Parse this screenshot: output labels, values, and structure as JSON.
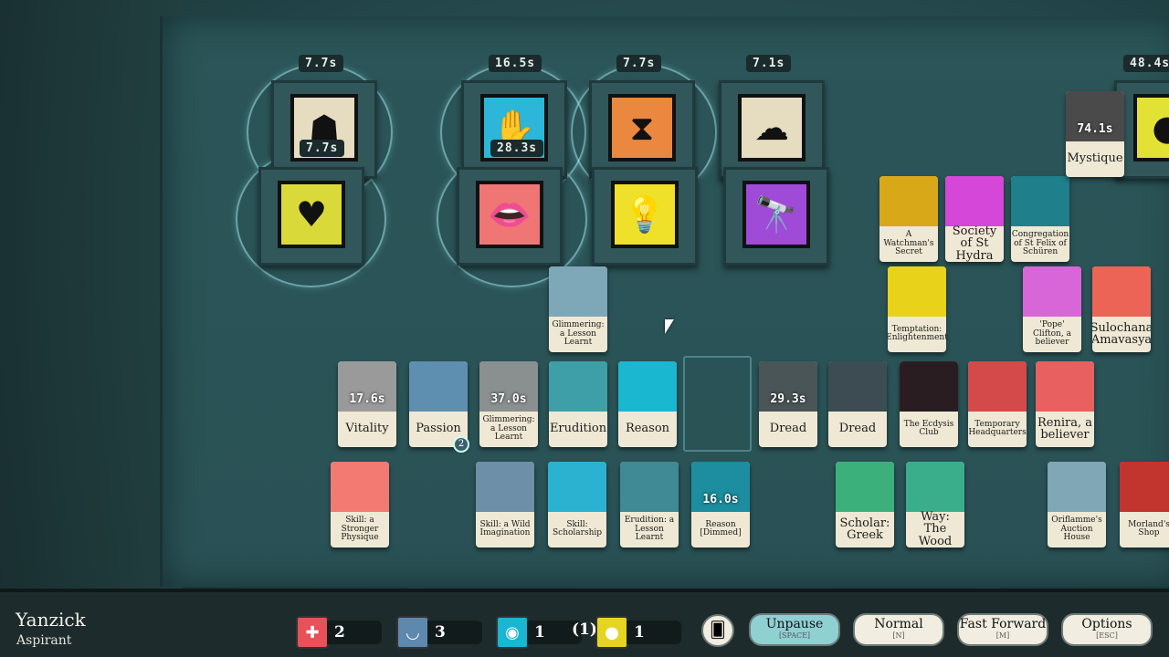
{
  "verbs": [
    {
      "icon": "mask-icon",
      "color": "#e6dcc0",
      "glyph": "☗",
      "timer": "7.7s"
    },
    {
      "icon": "heart-icon",
      "color": "#d9d93a",
      "glyph": "♥",
      "timer": "7.7s"
    },
    {
      "icon": "hand-eye-icon",
      "color": "#2cb6d9",
      "glyph": "✋",
      "timer": "16.5s"
    },
    {
      "icon": "lips-icon",
      "color": "#f07575",
      "glyph": "👄",
      "timer": "28.3s"
    },
    {
      "icon": "hourglass-icon",
      "color": "#e9883e",
      "glyph": "⧗",
      "timer": "7.7s"
    },
    {
      "icon": "lightbulb-icon",
      "color": "#efe02a",
      "glyph": "💡",
      "timer": ""
    },
    {
      "icon": "cloud-star-icon",
      "color": "#e6dcc0",
      "glyph": "☁",
      "timer": "7.1s"
    },
    {
      "icon": "telescope-icon",
      "color": "#a04ad8",
      "glyph": "🔭",
      "timer": ""
    },
    {
      "icon": "candle-icon",
      "color": "#e2e235",
      "glyph": "●",
      "timer": "48.4s"
    }
  ],
  "cards": [
    {
      "label": "Glimmering: a Lesson Learnt",
      "color": "#7ea8b8",
      "timer": ""
    },
    {
      "label": "Vitality",
      "color": "#9a9a9a",
      "timer": "17.6s",
      "big": true
    },
    {
      "label": "Passion",
      "color": "#5f8fb0",
      "timer": "",
      "big": true,
      "badge": "2"
    },
    {
      "label": "Glimmering: a Lesson Learnt",
      "color": "#8a8f90",
      "timer": "37.0s"
    },
    {
      "label": "Erudition",
      "color": "#3f9fa8",
      "timer": "",
      "big": true
    },
    {
      "label": "Reason",
      "color": "#19b7d0",
      "timer": "",
      "big": true
    },
    {
      "label": "Dread",
      "color": "#4a5558",
      "timer": "29.3s",
      "big": true
    },
    {
      "label": "Dread",
      "color": "#3c4c52",
      "timer": "",
      "big": true
    },
    {
      "label": "The Ecdysis Club",
      "color": "#2a1d22",
      "timer": ""
    },
    {
      "label": "Temporary Headquarters",
      "color": "#d44a4a",
      "timer": ""
    },
    {
      "label": "Renira, a believer",
      "color": "#e86060",
      "timer": "",
      "big": true
    },
    {
      "label": "Skill: a Stronger Physique",
      "color": "#f27a72",
      "timer": ""
    },
    {
      "label": "Skill: a Wild Imagination",
      "color": "#6d8fa8",
      "timer": ""
    },
    {
      "label": "Skill: Scholarship",
      "color": "#2ab2d0",
      "timer": ""
    },
    {
      "label": "Erudition: a Lesson Learnt",
      "color": "#3f8a94",
      "timer": ""
    },
    {
      "label": "Reason [Dimmed]",
      "color": "#1c8ea0",
      "timer": "16.0s"
    },
    {
      "label": "Scholar: Greek",
      "color": "#3cb07a",
      "timer": "",
      "big": true
    },
    {
      "label": "Way: The Wood",
      "color": "#3aae8a",
      "timer": "",
      "big": true
    },
    {
      "label": "Oriflamme's Auction House",
      "color": "#7fa7b6",
      "timer": ""
    },
    {
      "label": "Morland's Shop",
      "color": "#c2352f",
      "timer": ""
    },
    {
      "label": "A Watchman's Secret",
      "color": "#d9a818",
      "timer": ""
    },
    {
      "label": "Society of St Hydra",
      "color": "#d447d8",
      "timer": "",
      "big": true
    },
    {
      "label": "Congregation of St Felix of Schüren",
      "color": "#1f7f8a",
      "timer": ""
    },
    {
      "label": "Temptation: Enlightenment",
      "color": "#e9d21a",
      "timer": ""
    },
    {
      "label": "'Pope' Clifton, a believer",
      "color": "#d866d8",
      "timer": ""
    },
    {
      "label": "Sulochana Amavasya",
      "color": "#ec6455",
      "timer": "",
      "big": true
    },
    {
      "label": "Mystique",
      "color": "#4a4a4a",
      "timer": "74.1s",
      "big": true
    }
  ],
  "player": {
    "name": "Yanzick",
    "title": "Aspirant"
  },
  "resources": [
    {
      "icon": "health-icon",
      "color": "#e8505a",
      "glyph": "✚",
      "value": "2"
    },
    {
      "icon": "passion-icon",
      "color": "#5e88ad",
      "glyph": "◡",
      "value": "3"
    },
    {
      "icon": "reason-icon",
      "color": "#19b5d3",
      "glyph": "◉",
      "value": "1",
      "extra": "(1)"
    },
    {
      "icon": "funds-icon",
      "color": "#e6d422",
      "glyph": "●",
      "value": "1"
    }
  ],
  "controls": {
    "unpause": {
      "label": "Unpause",
      "key": "[SPACE]"
    },
    "normal": {
      "label": "Normal",
      "key": "[N]"
    },
    "fast": {
      "label": "Fast Forward",
      "key": "[M]"
    },
    "options": {
      "label": "Options",
      "key": "[ESC]"
    }
  }
}
